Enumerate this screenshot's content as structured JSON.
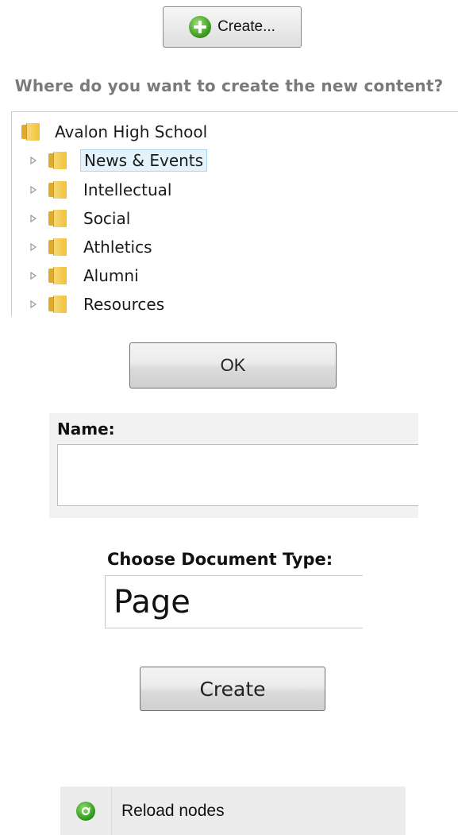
{
  "toolbar": {
    "create_label": "Create...",
    "create_icon": "plus-circle-icon"
  },
  "question": "Where do you want to create the new content?",
  "tree": {
    "root": {
      "label": "Avalon High School",
      "icon": "folder-icon"
    },
    "items": [
      {
        "label": "News & Events",
        "selected": true
      },
      {
        "label": "Intellectual",
        "selected": false
      },
      {
        "label": "Social",
        "selected": false
      },
      {
        "label": "Athletics",
        "selected": false
      },
      {
        "label": "Alumni",
        "selected": false
      },
      {
        "label": "Resources",
        "selected": false
      }
    ]
  },
  "ok_label": "OK",
  "name_field": {
    "label": "Name:",
    "value": ""
  },
  "document_type": {
    "label": "Choose Document Type:",
    "value": "Page"
  },
  "create_label": "Create",
  "reload": {
    "label": "Reload nodes",
    "icon": "refresh-icon"
  },
  "colors": {
    "selection_bg": "#e4f3fb",
    "selection_border": "#a8d6ef",
    "folder": "#f2c237",
    "accent_green": "#3c9a1f",
    "question_text": "#7a7a7a"
  }
}
